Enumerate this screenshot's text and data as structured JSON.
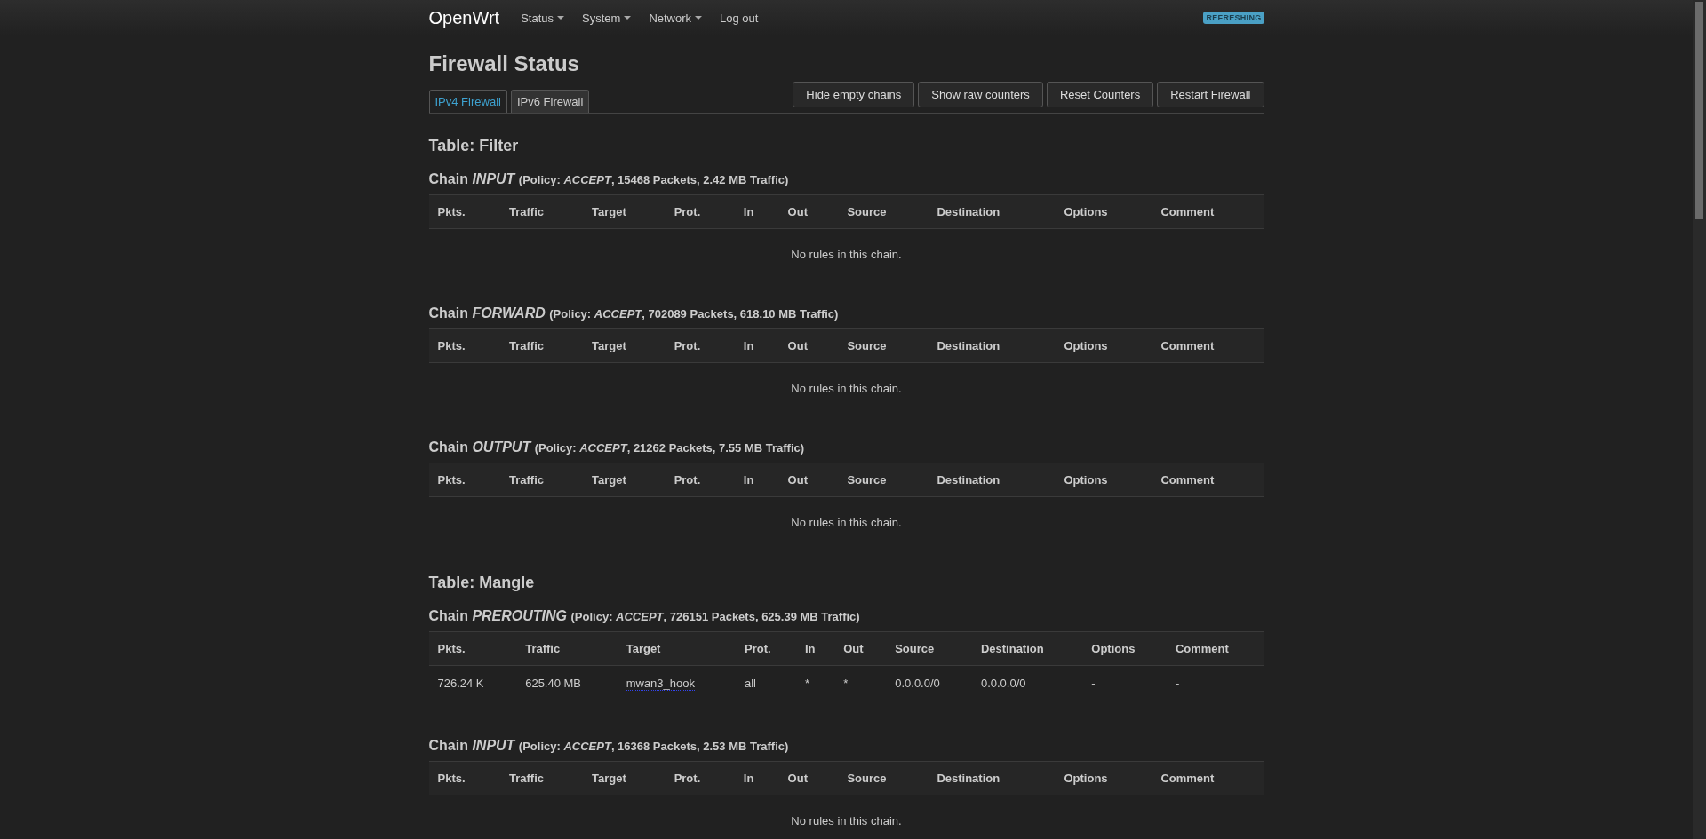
{
  "header": {
    "brand": "OpenWrt",
    "nav": [
      {
        "label": "Status",
        "dropdown": true
      },
      {
        "label": "System",
        "dropdown": true
      },
      {
        "label": "Network",
        "dropdown": true
      },
      {
        "label": "Log out",
        "dropdown": false
      }
    ],
    "badge": "REFRESHING"
  },
  "page": {
    "title": "Firewall Status",
    "tabs": [
      {
        "label": "IPv4 Firewall",
        "selected": true
      },
      {
        "label": "IPv6 Firewall",
        "selected": false
      }
    ],
    "actions": [
      "Hide empty chains",
      "Show raw counters",
      "Reset Counters",
      "Restart Firewall"
    ]
  },
  "tables": [
    {
      "title": "Table: Filter",
      "chains": [
        {
          "title": "Chain *INPUT*",
          "policy": "(Policy: *ACCEPT*, 15468 Packets, 2.42 MB Traffic)",
          "columns": [
            "Pkts.",
            "Traffic",
            "Target",
            "Prot.",
            "In",
            "Out",
            "Source",
            "Destination",
            "Options",
            "Comment"
          ],
          "empty": "No rules in this chain."
        },
        {
          "title": "Chain *FORWARD*",
          "policy": "(Policy: *ACCEPT*, 702089 Packets, 618.10 MB Traffic)",
          "columns": [
            "Pkts.",
            "Traffic",
            "Target",
            "Prot.",
            "In",
            "Out",
            "Source",
            "Destination",
            "Options",
            "Comment"
          ],
          "empty": "No rules in this chain."
        },
        {
          "title": "Chain *OUTPUT*",
          "policy": "(Policy: *ACCEPT*, 21262 Packets, 7.55 MB Traffic)",
          "columns": [
            "Pkts.",
            "Traffic",
            "Target",
            "Prot.",
            "In",
            "Out",
            "Source",
            "Destination",
            "Options",
            "Comment"
          ],
          "empty": "No rules in this chain."
        }
      ]
    },
    {
      "title": "Table: Mangle",
      "chains": [
        {
          "title": "Chain *PREROUTING*",
          "policy": "(Policy: *ACCEPT*, 726151 Packets, 625.39 MB Traffic)",
          "columns": [
            "Pkts.",
            "Traffic",
            "Target",
            "Prot.",
            "In",
            "Out",
            "Source",
            "Destination",
            "Options",
            "Comment"
          ],
          "rows": [
            {
              "cells": [
                {
                  "text": "726.24 K",
                  "kind": "text"
                },
                {
                  "text": "625.40 MB",
                  "kind": "text"
                },
                {
                  "text": "mwan3_hook",
                  "kind": "link"
                },
                {
                  "text": "all",
                  "kind": "text"
                },
                {
                  "text": "*",
                  "kind": "text"
                },
                {
                  "text": "*",
                  "kind": "text"
                },
                {
                  "text": "0.0.0.0/0",
                  "kind": "text"
                },
                {
                  "text": "0.0.0.0/0",
                  "kind": "text"
                },
                {
                  "text": "-",
                  "kind": "text"
                },
                {
                  "text": "-",
                  "kind": "text"
                }
              ]
            }
          ]
        },
        {
          "title": "Chain *INPUT*",
          "policy": "(Policy: *ACCEPT*, 16368 Packets, 2.53 MB Traffic)",
          "columns": [
            "Pkts.",
            "Traffic",
            "Target",
            "Prot.",
            "In",
            "Out",
            "Source",
            "Destination",
            "Options",
            "Comment"
          ],
          "empty": "No rules in this chain."
        }
      ]
    }
  ]
}
